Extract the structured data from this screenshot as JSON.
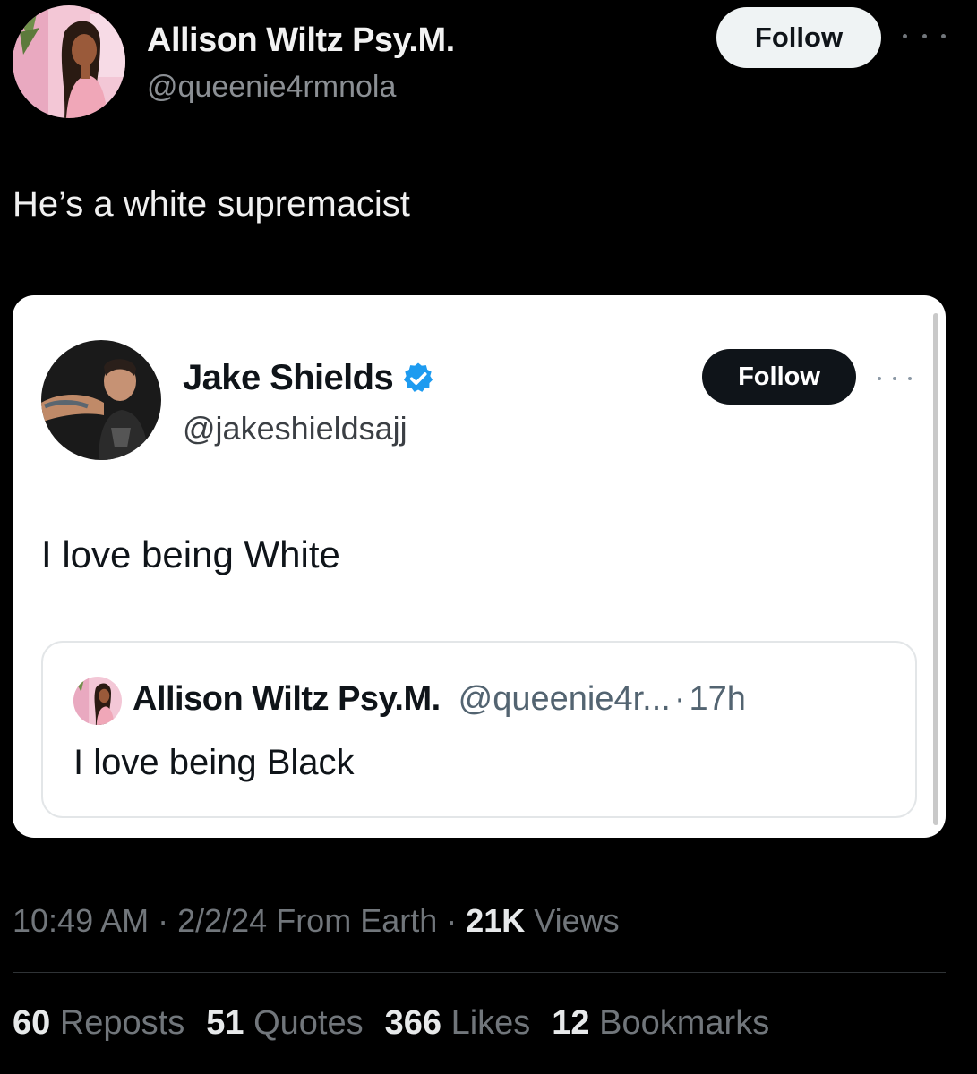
{
  "tweet": {
    "author_name": "Allison Wiltz Psy.M.",
    "author_handle": "@queenie4rmnola",
    "follow_label": "Follow",
    "text": "He’s a white supremacist",
    "avatar_icon": "cartoon-woman-avatar",
    "more_icon": "more-dots-icon"
  },
  "quoted": {
    "author_name": "Jake Shields",
    "author_handle": "@jakeshieldsajj",
    "verified_icon": "verified-badge-icon",
    "verified_color": "#1d9bf0",
    "follow_label": "Follow",
    "text": "I love being White",
    "avatar_icon": "man-photo-avatar",
    "nested": {
      "author_name": "Allison Wiltz Psy.M.",
      "author_handle": "@queenie4r...",
      "separator": "·",
      "time": "17h",
      "text": "I love being Black"
    }
  },
  "meta": {
    "time": "10:49 AM",
    "sep1": " · ",
    "date": "2/2/24",
    "source": " From Earth",
    "sep2": " · ",
    "views_count": "21K",
    "views_label": " Views"
  },
  "stats": [
    {
      "count": "60",
      "label": " Reposts"
    },
    {
      "count": "51",
      "label": " Quotes"
    },
    {
      "count": "366",
      "label": " Likes"
    },
    {
      "count": "12",
      "label": " Bookmarks"
    }
  ]
}
